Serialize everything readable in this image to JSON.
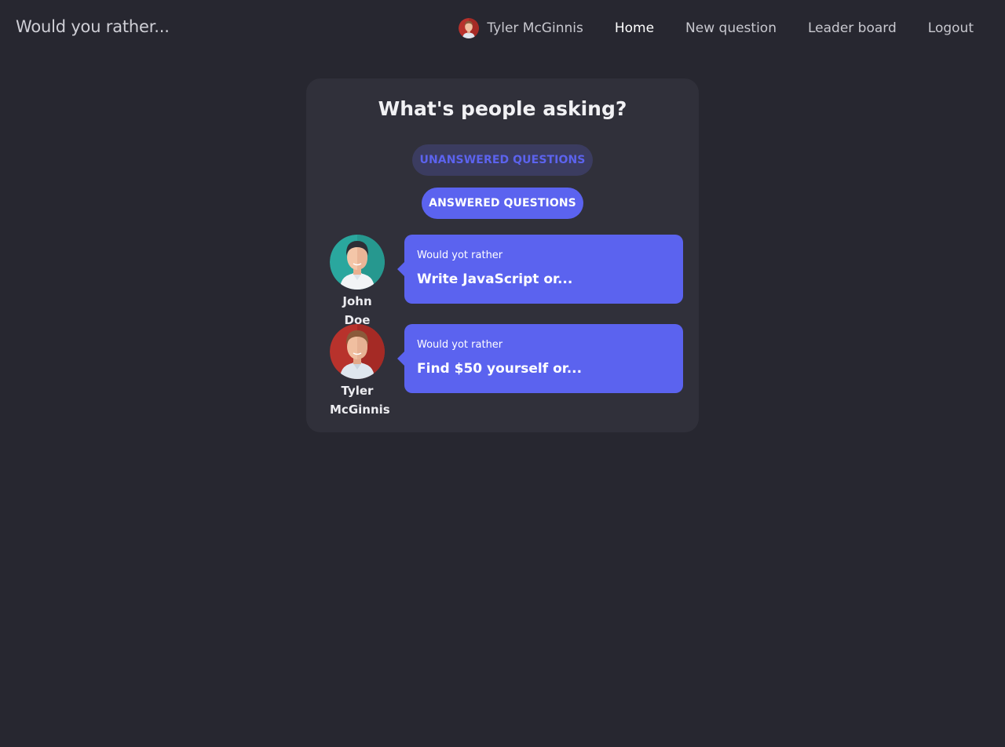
{
  "app": {
    "title": "Would you rather..."
  },
  "header": {
    "user_name": "Tyler McGinnis",
    "nav": [
      {
        "label": "Home",
        "active": true
      },
      {
        "label": "New question"
      },
      {
        "label": "Leader board"
      },
      {
        "label": "Logout"
      }
    ]
  },
  "main": {
    "title": "What's people asking?",
    "tabs": {
      "unanswered_label": "UNANSWERED QUESTIONS",
      "answered_label": "ANSWERED QUESTIONS"
    },
    "questions": [
      {
        "author": "John Doe",
        "avatar_icon": "man-avatar-teal-icon",
        "avatar_bg": "#2aa79e",
        "lead": "Would yot rather",
        "text": "Write JavaScript or..."
      },
      {
        "author": "Tyler McGinnis",
        "avatar_icon": "man-avatar-red-icon",
        "avatar_bg": "#b8322c",
        "lead": "Would yot rather",
        "text": "Find $50 yourself or..."
      }
    ]
  },
  "colors": {
    "background": "#272730",
    "panel": "#30303a",
    "accent": "#5b63ef",
    "pill_inactive_bg": "#3b3c60"
  }
}
